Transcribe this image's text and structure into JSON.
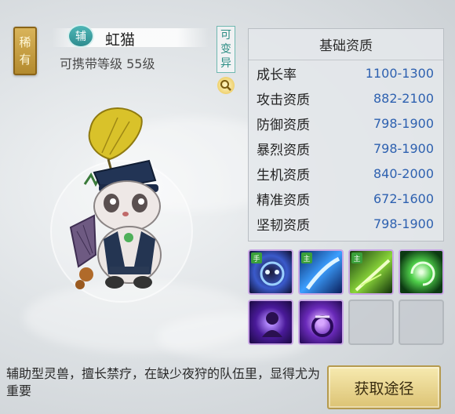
{
  "pet": {
    "rarity": [
      "稀",
      "有"
    ],
    "role": "辅",
    "name": "虹猫",
    "carry_level": "可携带等级 55级",
    "mutate_tag": [
      "可",
      "变",
      "异"
    ]
  },
  "stats": {
    "title": "基础资质",
    "rows": [
      {
        "label": "成长率",
        "value": "1100-1300"
      },
      {
        "label": "攻击资质",
        "value": "882-2100"
      },
      {
        "label": "防御资质",
        "value": "798-1900"
      },
      {
        "label": "暴烈资质",
        "value": "798-1900"
      },
      {
        "label": "生机资质",
        "value": "840-2000"
      },
      {
        "label": "精准资质",
        "value": "672-1600"
      },
      {
        "label": "坚韧资质",
        "value": "798-1900"
      }
    ]
  },
  "skills": {
    "tags": [
      "手",
      "主",
      "主"
    ]
  },
  "description": "辅助型灵兽，擅长禁疗，在缺少夜狩的队伍里，显得尤为重要",
  "acquire_button": "获取途径"
}
